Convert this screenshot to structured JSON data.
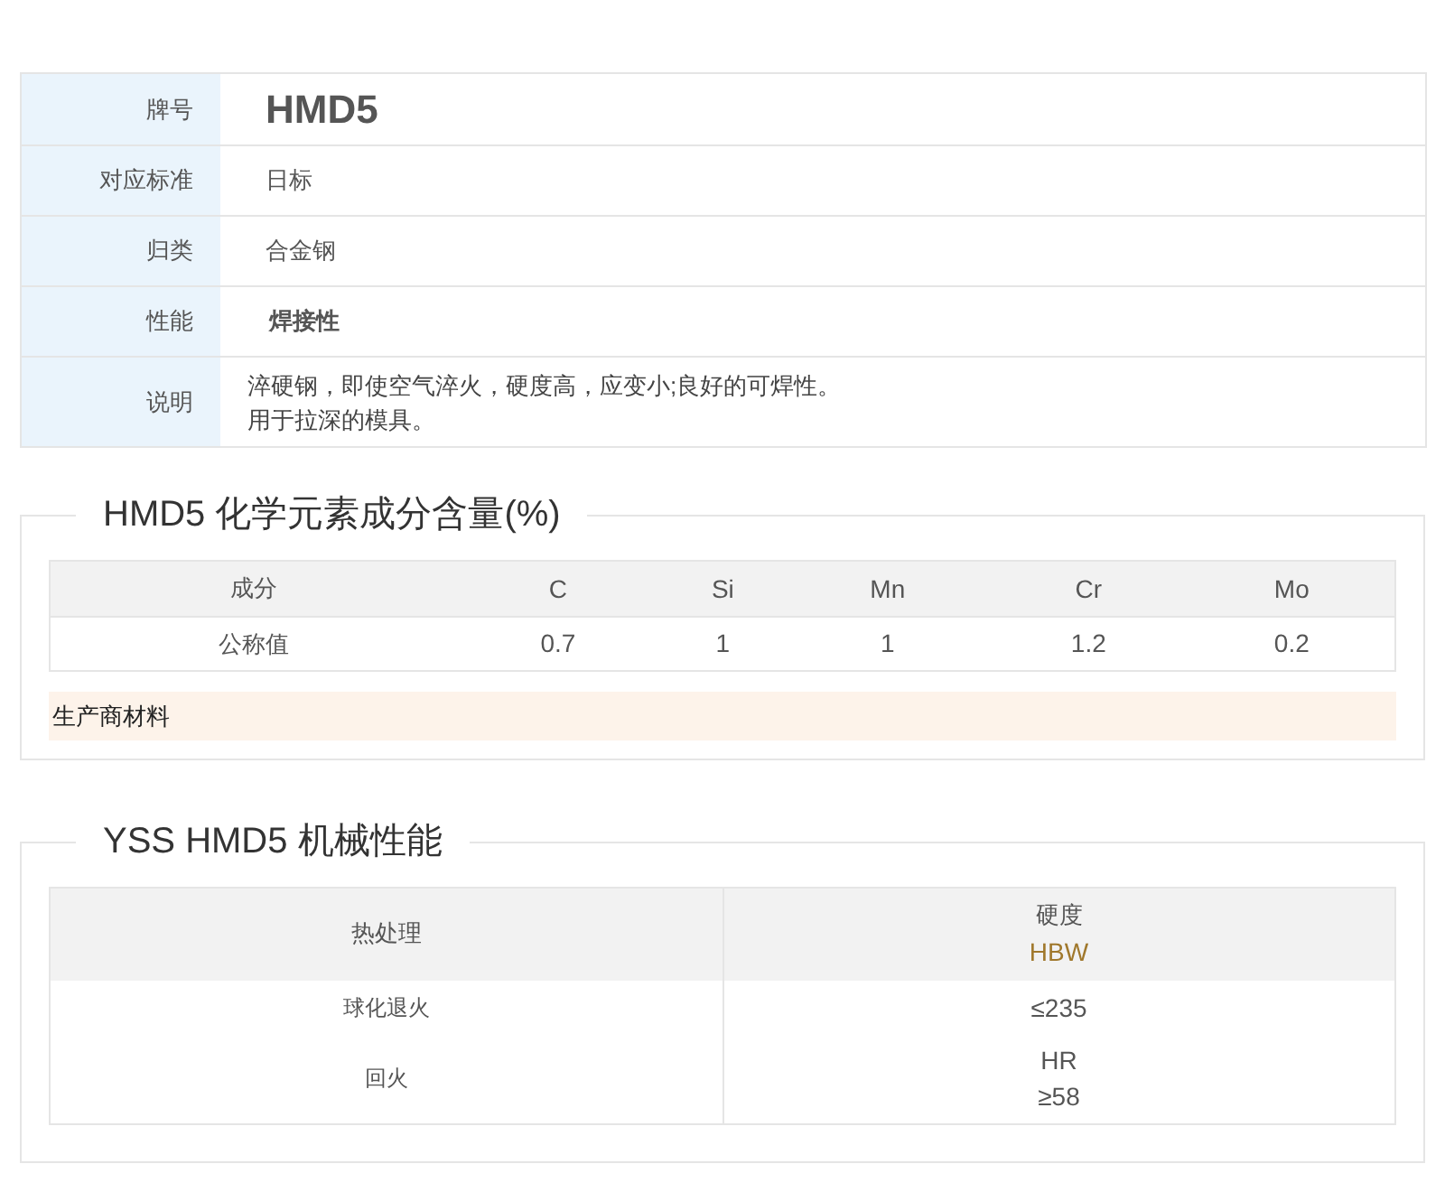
{
  "spec": [
    {
      "label": "牌号",
      "kind": "title",
      "lines": [
        "HMD5"
      ]
    },
    {
      "label": "对应标准",
      "kind": "text",
      "lines": [
        "日标"
      ]
    },
    {
      "label": "归类",
      "kind": "text",
      "lines": [
        "合金钢"
      ]
    },
    {
      "label": "性能",
      "kind": "bold",
      "lines": [
        "焊接性"
      ]
    },
    {
      "label": "说明",
      "kind": "note",
      "lines": [
        "淬硬钢，即使空气淬火，硬度高，应变小;良好的可焊性。",
        "用于拉深的模具。"
      ]
    }
  ],
  "chemistry": {
    "title": "HMD5 化学元素成分含量(%)",
    "columns": [
      "成分",
      "C",
      "Si",
      "Mn",
      "Cr",
      "Mo"
    ],
    "rows": [
      [
        "公称值",
        "0.7",
        "1",
        "1",
        "1.2",
        "0.2"
      ]
    ],
    "note": "生产商材料"
  },
  "mechanical": {
    "title": "YSS HMD5 机械性能",
    "columns": [
      {
        "title": "热处理"
      },
      {
        "title": "硬度",
        "unit": "HBW"
      }
    ],
    "rows": [
      {
        "treatment": "球化退火",
        "hardness": [
          "≤235"
        ]
      },
      {
        "treatment": "回火",
        "hardness": [
          "HR",
          "≥58"
        ]
      }
    ]
  }
}
